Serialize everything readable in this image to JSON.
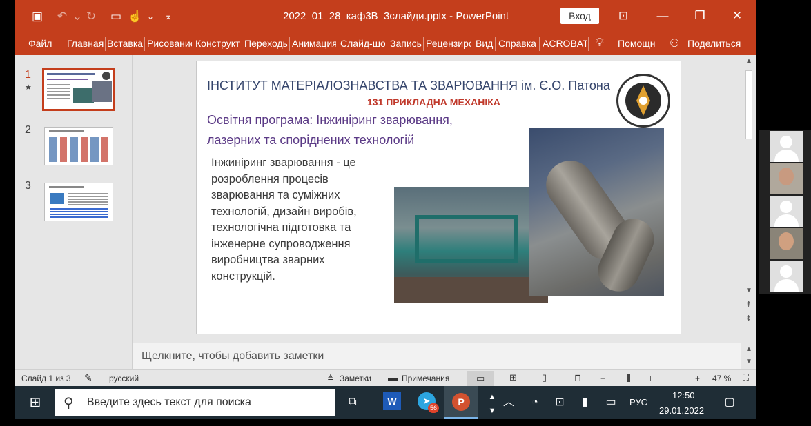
{
  "window": {
    "doc_title": "2022_01_28_каф3В_3слайди.pptx  -  PowerPoint",
    "sign_in": "Вход",
    "min_icon": "—",
    "restore_icon": "❐",
    "close_icon": "✕"
  },
  "ribbon": {
    "tabs": [
      "Файл",
      "Главная",
      "Вставка",
      "Рисование",
      "Конструктор",
      "Переходы",
      "Анимация",
      "Слайд-шоу",
      "Запись",
      "Рецензирование",
      "Вид",
      "Справка",
      "ACROBAT"
    ],
    "help": "Помощн",
    "share": "Поделиться"
  },
  "thumbnails": [
    {
      "num": "1",
      "star": "★"
    },
    {
      "num": "2"
    },
    {
      "num": "3"
    }
  ],
  "slide": {
    "title": "ІНСТИТУТ МАТЕРІАЛОЗНАВСТВА ТА ЗВАРЮВАННЯ ім. Є.О. Патона",
    "subtitle": "131 ПРИКЛАДНА МЕХАНІКА",
    "program_line1": "Освітня програма: Інжиніринг зварювання,",
    "program_line2": "лазерних та споріднених технологій",
    "body": "Інжиніринг зварювання -  це розроблення процесів зварювання та суміжних технологій, дизайн виробів, технологічна підготовка та інженерне супроводження виробництва зварних конструкцій."
  },
  "notes": {
    "placeholder": "Щелкните, чтобы добавить заметки"
  },
  "status": {
    "slide_info": "Слайд 1 из 3",
    "language": "русский",
    "notes": "Заметки",
    "comments": "Примечания",
    "zoom": "47 %",
    "minus": "−",
    "plus": "+"
  },
  "taskbar": {
    "search_placeholder": "Введите здесь текст для поиска",
    "telegram_badge": "56",
    "lang": "РУС",
    "time": "12:50",
    "date": "29.01.2022"
  }
}
